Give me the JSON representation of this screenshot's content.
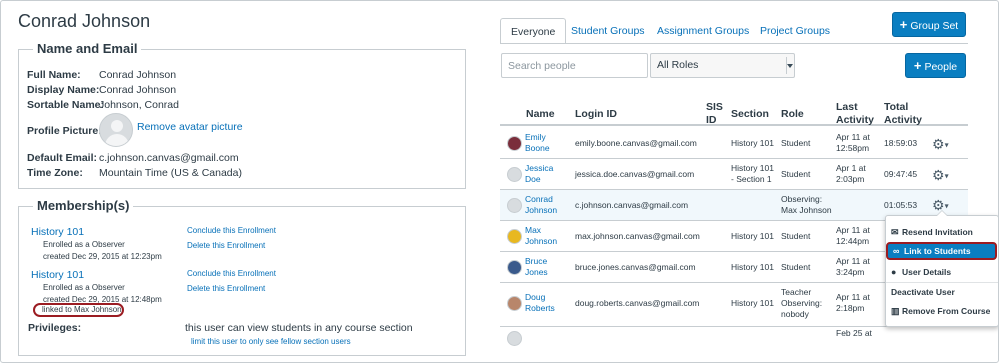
{
  "page": {
    "title": "Conrad Johnson"
  },
  "name_email": {
    "legend": "Name and Email",
    "full_name_label": "Full Name:",
    "full_name": "Conrad Johnson",
    "display_name_label": "Display Name:",
    "display_name": "Conrad Johnson",
    "sortable_name_label": "Sortable Name:",
    "sortable_name": "Johnson, Conrad",
    "profile_picture_label": "Profile Picture:",
    "remove_avatar": "Remove avatar picture",
    "default_email_label": "Default Email:",
    "default_email": "c.johnson.canvas@gmail.com",
    "time_zone_label": "Time Zone:",
    "time_zone": "Mountain Time (US & Canada)"
  },
  "membership": {
    "legend": "Membership(s)",
    "enrollments": [
      {
        "course": "History 101",
        "enrolled_as": "Enrolled as a Observer",
        "created": "created Dec 29, 2015 at 12:23pm",
        "conclude": "Conclude this Enrollment",
        "delete": "Delete this Enrollment"
      },
      {
        "course": "History 101",
        "enrolled_as": "Enrolled as a Observer",
        "created": "created Dec 29, 2015 at 12:48pm",
        "linked": "linked to Max Johnson",
        "conclude": "Conclude this Enrollment",
        "delete": "Delete this Enrollment"
      }
    ],
    "privileges_label": "Privileges:",
    "privileges_value": "this user can view students in any course section",
    "privileges_link": "limit this user to only see fellow section users"
  },
  "tabs": [
    "Everyone",
    "Student Groups",
    "Assignment Groups",
    "Project Groups"
  ],
  "buttons": {
    "group_set": "Group Set",
    "people": "People"
  },
  "search": {
    "placeholder": "Search people"
  },
  "role_filter": {
    "selected": "All Roles"
  },
  "table": {
    "headers": {
      "name": "Name",
      "login": "Login ID",
      "sis": "SIS ID",
      "section": "Section",
      "role": "Role",
      "last": "Last Activity",
      "total": "Total Activity"
    },
    "rows": [
      {
        "name": "Emily Boone",
        "login": "emily.boone.canvas@gmail.com",
        "section": "History 101",
        "role": "Student",
        "last": "Apr 11 at 12:58pm",
        "total": "18:59:03",
        "avatar_color": "#7a2e3b"
      },
      {
        "name": "Jessica Doe",
        "login": "jessica.doe.canvas@gmail.com",
        "section": "History 101 - Section 1",
        "role": "Student",
        "last": "Apr 1 at 2:03pm",
        "total": "09:47:45",
        "avatar_color": "#d8dcdf"
      },
      {
        "name": "Conrad Johnson",
        "login": "c.johnson.canvas@gmail.com",
        "section": "",
        "role": "Observing: Max Johnson",
        "last": "",
        "total": "01:05:53",
        "avatar_color": "#d8dcdf"
      },
      {
        "name": "Max Johnson",
        "login": "max.johnson.canvas@gmail.com",
        "section": "History 101",
        "role": "Student",
        "last": "Apr 11 at 12:44pm",
        "total": "",
        "avatar_color": "#e8b820"
      },
      {
        "name": "Bruce Jones",
        "login": "bruce.jones.canvas@gmail.com",
        "section": "History 101",
        "role": "Student",
        "last": "Apr 11 at 3:24pm",
        "total": "",
        "avatar_color": "#3a5a8c"
      },
      {
        "name": "Doug Roberts",
        "login": "doug.roberts.canvas@gmail.com",
        "section": "History 101",
        "role": "Teacher Observing: nobody",
        "last": "Apr 11 at 2:18pm",
        "total": "",
        "avatar_color": "#b8866b"
      }
    ],
    "partial_row_last": "Feb 25 at"
  },
  "menu": {
    "items": [
      "Resend Invitation",
      "Link to Students",
      "User Details",
      "Deactivate User",
      "Remove From Course"
    ]
  },
  "colors": {
    "primary": "#0a7ec1",
    "link": "#0770b8",
    "highlight_border": "#9b1c22"
  }
}
